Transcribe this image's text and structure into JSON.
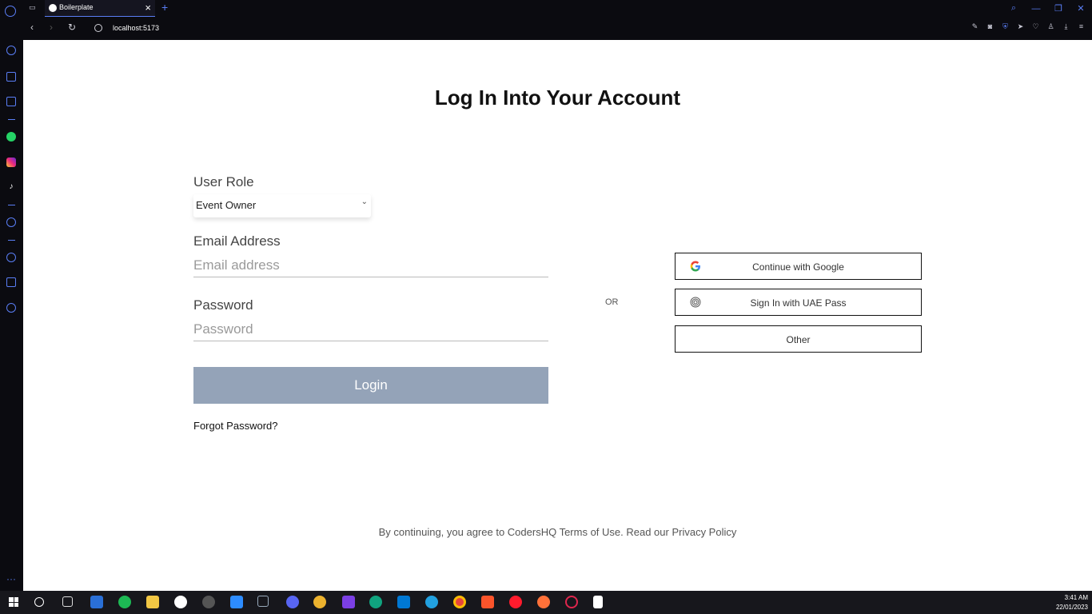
{
  "browser": {
    "tab_title": "Boilerplate",
    "url": "localhost:5173"
  },
  "page": {
    "title": "Log In Into Your Account",
    "role_label": "User Role",
    "role_value": "Event Owner",
    "email_label": "Email Address",
    "email_placeholder": "Email address",
    "password_label": "Password",
    "password_placeholder": "Password",
    "login_label": "Login",
    "forgot_label": "Forgot Password?",
    "or_label": "OR",
    "google_label": "Continue with Google",
    "uaepass_label": "Sign In with UAE Pass",
    "other_label": "Other",
    "terms": "By continuing, you agree to CodersHQ Terms of Use. Read our Privacy Policy"
  },
  "taskbar": {
    "time": "3:41 AM",
    "date": "22/01/2023"
  },
  "colors": {
    "accent": "#5a7ef5",
    "login_button": "#94a3b8"
  }
}
